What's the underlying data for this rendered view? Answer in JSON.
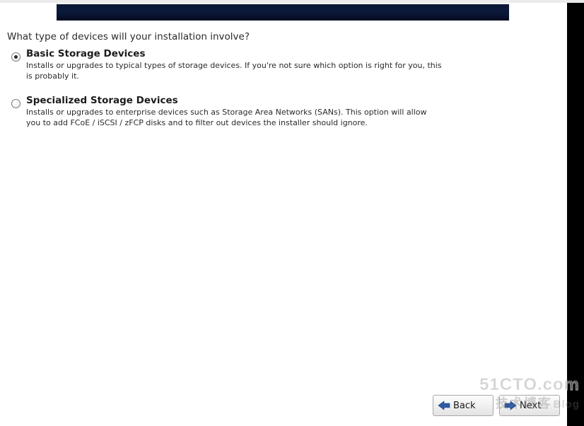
{
  "question": "What type of devices will your installation involve?",
  "options": [
    {
      "title": "Basic Storage Devices",
      "desc": "Installs or upgrades to typical types of storage devices.  If you're not sure which option is right for you, this is probably it.",
      "selected": true
    },
    {
      "title": "Specialized Storage Devices",
      "desc": "Installs or upgrades to enterprise devices such as Storage Area Networks (SANs). This option will allow you to add FCoE / iSCSI / zFCP disks and to filter out devices the installer should ignore.",
      "selected": false
    }
  ],
  "buttons": {
    "back": "Back",
    "next": "Next"
  },
  "watermark": {
    "line1": "51CTO.com",
    "line2_cn": "技术博客",
    "line2_suffix": "Blog"
  },
  "colors": {
    "banner_dark": "#0a1633",
    "arrow_blue": "#2e5aa6"
  }
}
